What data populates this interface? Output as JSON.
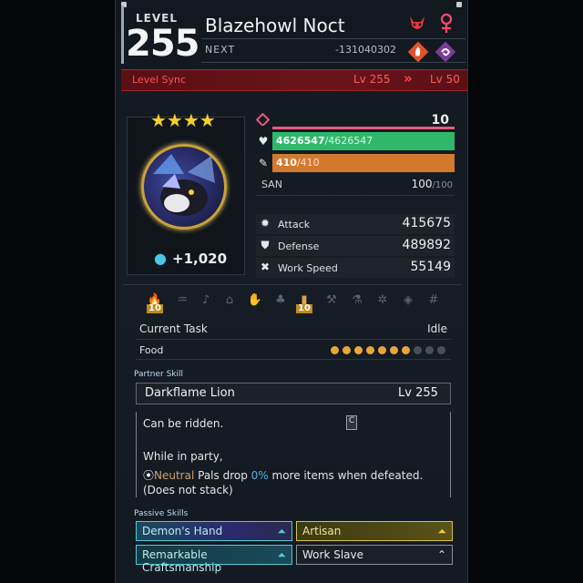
{
  "header": {
    "level_label": "LEVEL",
    "level": "255",
    "name": "Blazehowl Noct",
    "next_label": "NEXT",
    "next_value": "-131040302"
  },
  "level_sync": {
    "label": "Level Sync",
    "from": "Lv 255",
    "arrow": "»",
    "to": "Lv 50"
  },
  "portrait": {
    "stars": "★★★★",
    "soul_bonus": "+1,020"
  },
  "stats": {
    "friendship": "10",
    "hp_current": "4626547",
    "hp_max": "/4626547",
    "sp_current": "410",
    "sp_max": "/410",
    "san_label": "SAN",
    "san_current": "100",
    "san_max": "/100",
    "attack_label": "Attack",
    "attack": "415675",
    "defense_label": "Defense",
    "defense": "489892",
    "work_speed_label": "Work Speed",
    "work_speed": "55149"
  },
  "work": {
    "kindling_level": "10",
    "mining_level": "10"
  },
  "task": {
    "label": "Current Task",
    "value": "Idle",
    "food_label": "Food",
    "food_filled": 7,
    "food_total": 10
  },
  "partner": {
    "section": "Partner Skill",
    "name": "Darkflame Lion",
    "level": "Lv  255",
    "line1": "Can be ridden.",
    "line2": "While in party,",
    "neutral": "Neutral",
    "mid1": " Pals drop ",
    "pct": "0%",
    "mid2": " more items when defeated.",
    "line4": "(Does not stack)",
    "tab": "C"
  },
  "passives": {
    "section": "Passive Skills",
    "s1": "Demon's Hand",
    "s2": "Artisan",
    "s3": "Remarkable Craftsmanship",
    "s4": "Work Slave"
  },
  "colors": {
    "hp": "#2fb86a",
    "sp": "#d3792e",
    "level_sync": "#ff5252",
    "gold": "#c8a33a"
  }
}
